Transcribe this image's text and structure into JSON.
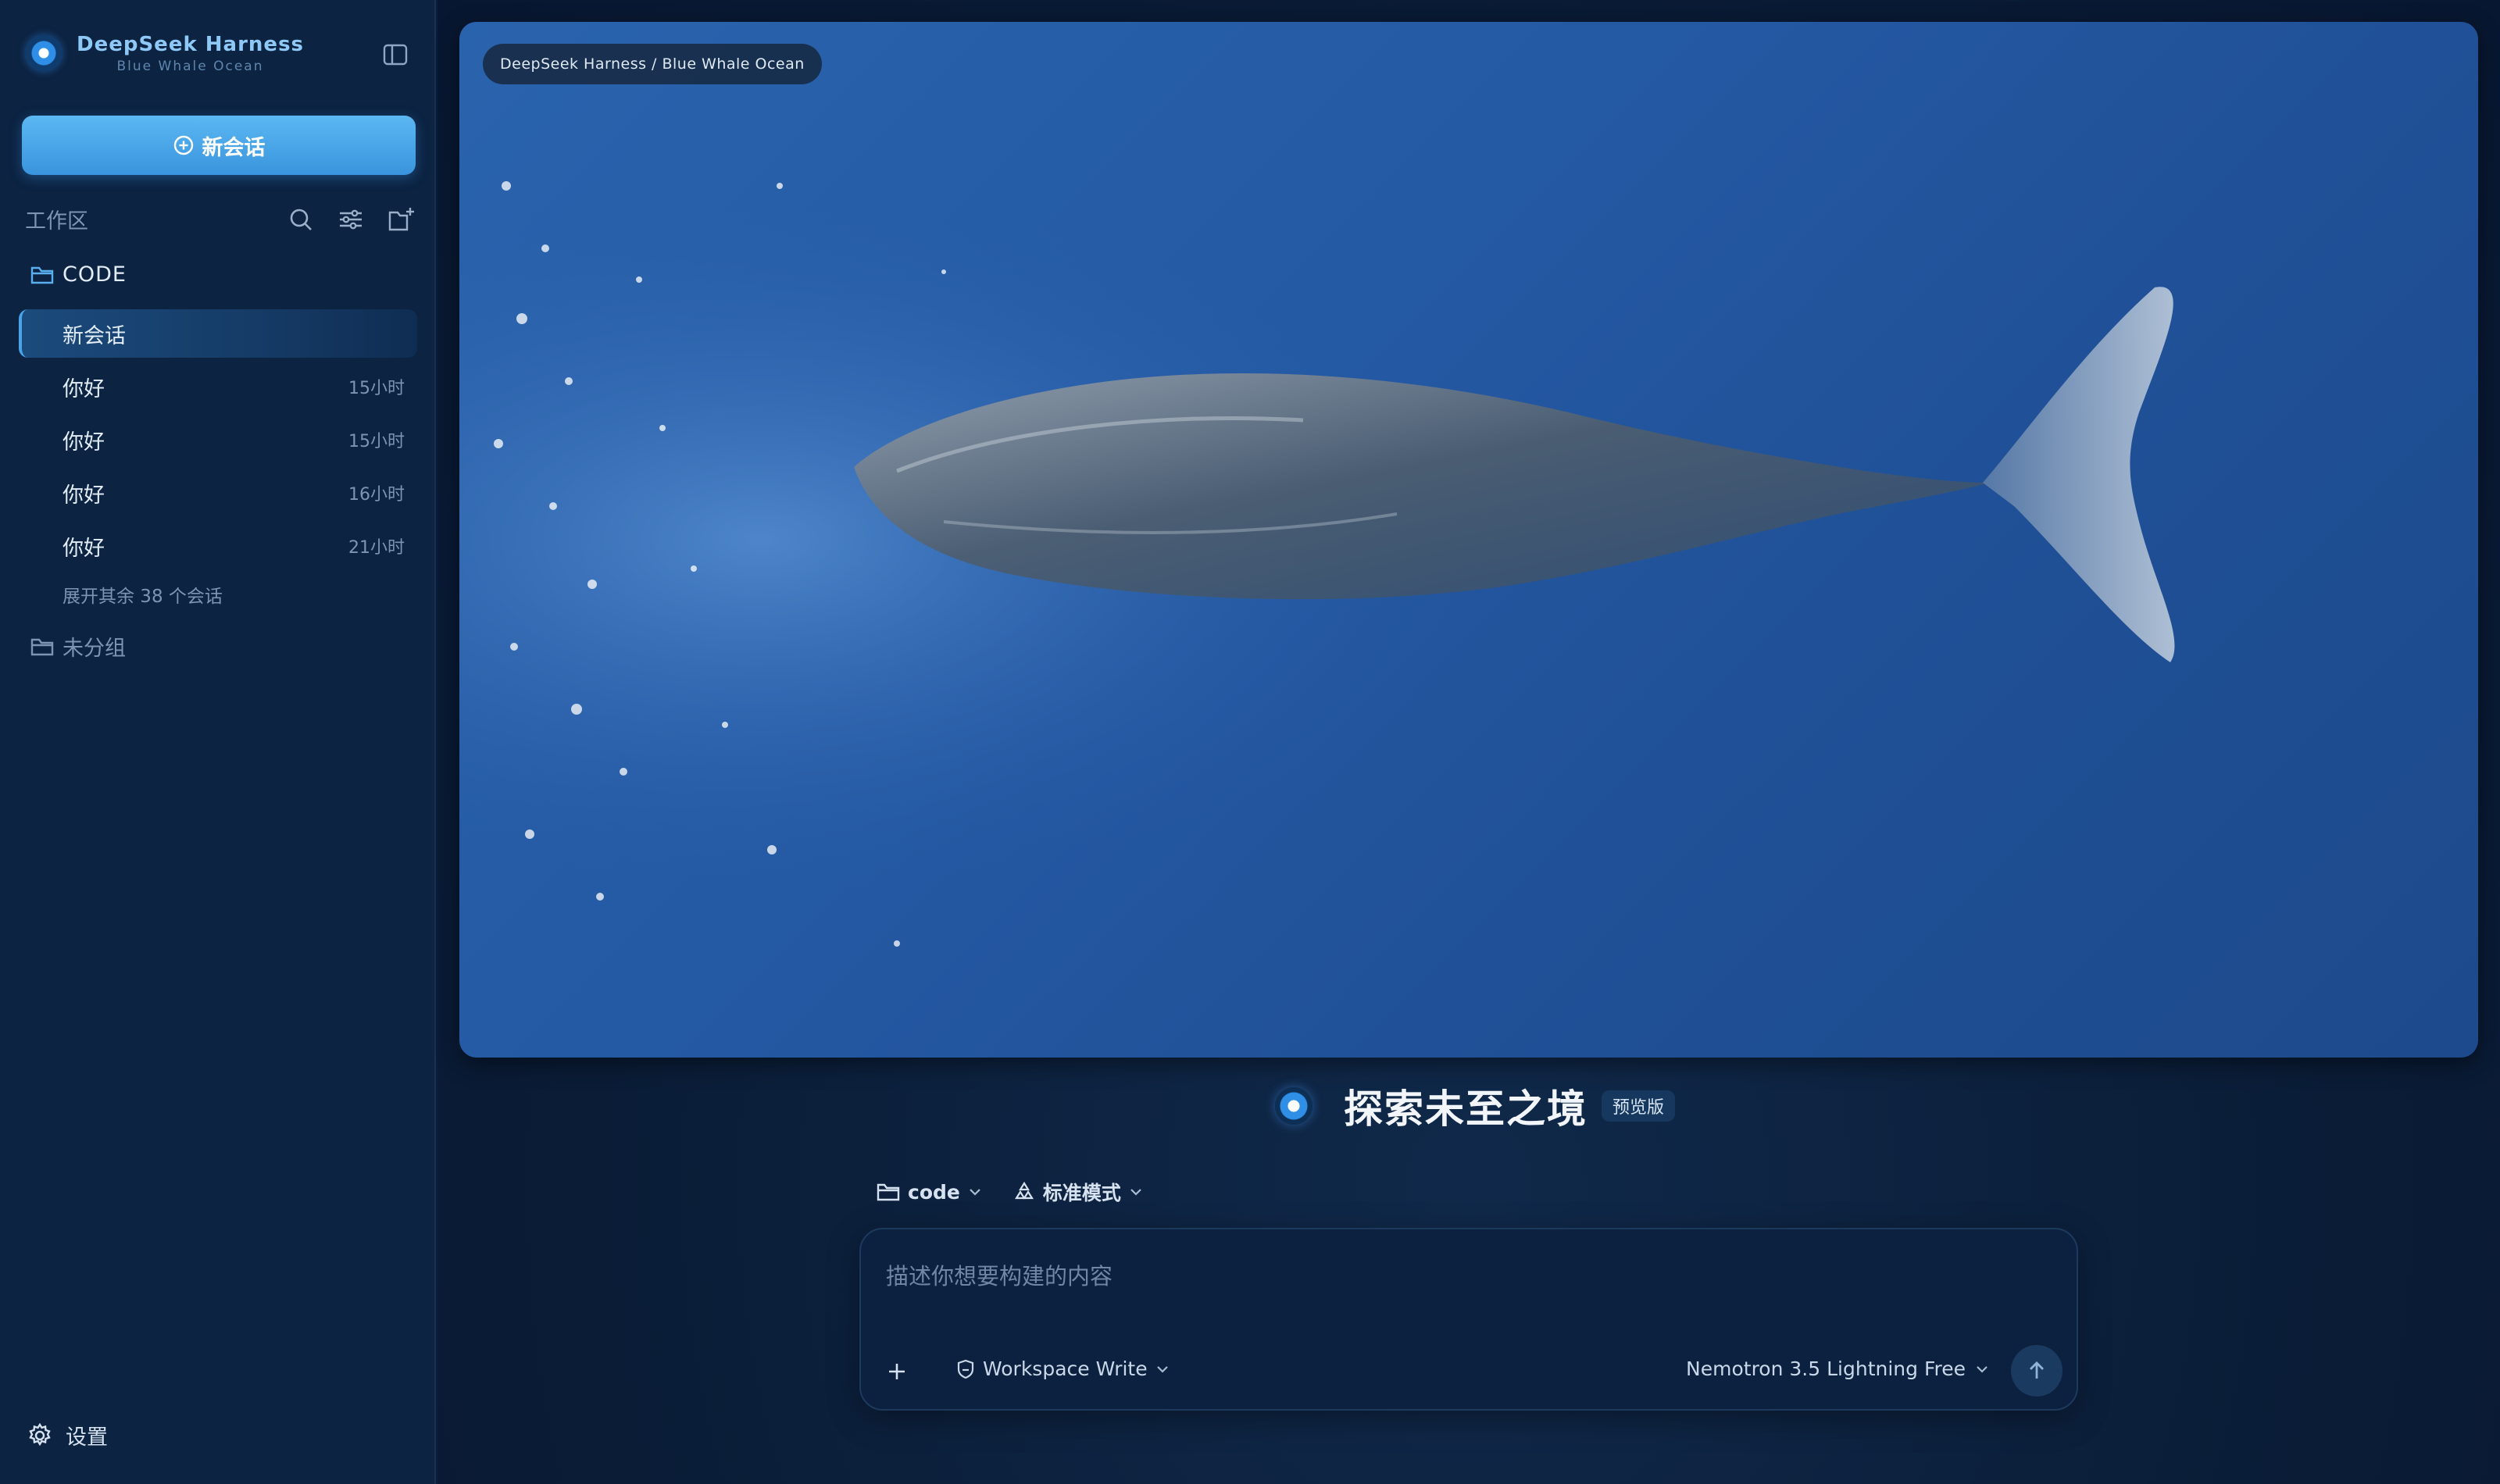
{
  "sidebar": {
    "brand_title": "DeepSeek Harness",
    "brand_subtitle": "Blue Whale Ocean",
    "new_chat_label": "新会话",
    "workspace_label": "工作区",
    "folders": [
      {
        "name": "CODE"
      },
      {
        "name": "未分组"
      }
    ],
    "sessions": [
      {
        "title": "新会话",
        "time": "",
        "active": true
      },
      {
        "title": "你好",
        "time": "15小时"
      },
      {
        "title": "你好",
        "time": "15小时"
      },
      {
        "title": "你好",
        "time": "16小时"
      },
      {
        "title": "你好",
        "time": "21小时"
      }
    ],
    "expand_more": "展开其余 38 个会话",
    "settings_label": "设置"
  },
  "hero": {
    "badge": "DeepSeek Harness / Blue Whale Ocean"
  },
  "main": {
    "title": "探索未至之境",
    "badge": "预览版",
    "context": {
      "folder": "code",
      "mode": "标准模式"
    },
    "composer": {
      "placeholder": "描述你想要构建的内容",
      "value": "",
      "permission": "Workspace Write",
      "model": "Nemotron 3.5 Lightning Free"
    }
  },
  "colors": {
    "accent": "#4aa3e8",
    "sidebar_bg": "#0c2342",
    "main_bg": "#0a1c36",
    "ocean": "#2459a3"
  },
  "icons": [
    "sidebar-toggle-icon",
    "plus-circle-icon",
    "search-icon",
    "sliders-icon",
    "folder-plus-icon",
    "folder-icon",
    "gear-icon",
    "recycle-icon",
    "chevron-down-icon",
    "plus-icon",
    "shield-edit-icon",
    "arrow-up-icon"
  ]
}
